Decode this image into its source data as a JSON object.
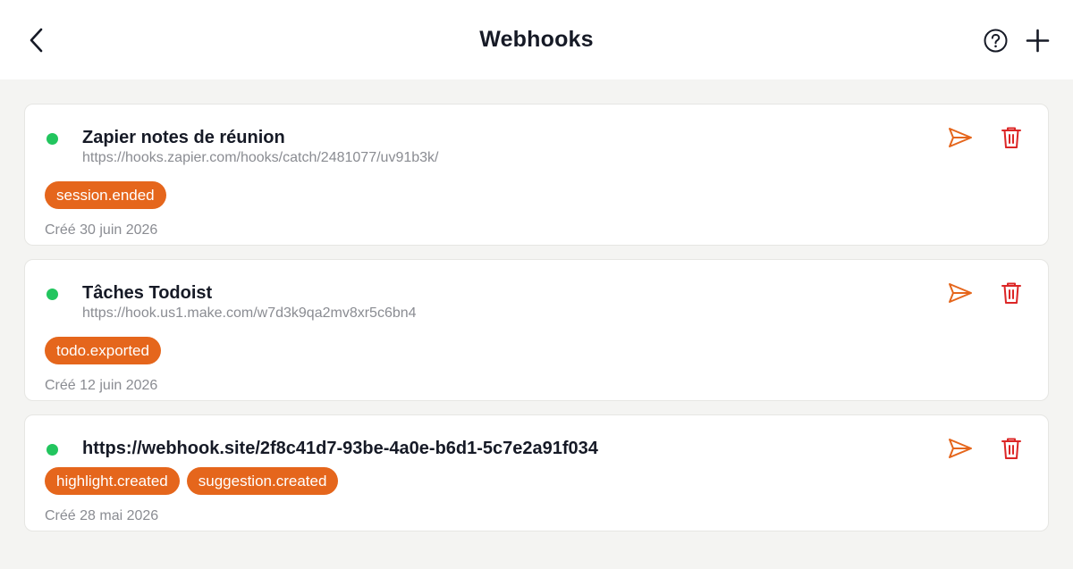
{
  "header": {
    "title": "Webhooks",
    "back_icon": "chevron-left-icon",
    "help_icon": "help-circle-icon",
    "add_icon": "plus-icon"
  },
  "colors": {
    "accent": "#e5661c",
    "delete": "#dc2626",
    "active": "#22c55e",
    "muted_text": "#8a8c92",
    "background": "#f4f4f2"
  },
  "webhooks": [
    {
      "name": "Zapier notes de réunion",
      "url": "https://hooks.zapier.com/hooks/catch/2481077/uv91b3k/",
      "events": [
        "session.ended"
      ],
      "created": "Créé 30 juin 2026",
      "status": "active"
    },
    {
      "name": "Tâches Todoist",
      "url": "https://hook.us1.make.com/w7d3k9qa2mv8xr5c6bn4",
      "events": [
        "todo.exported"
      ],
      "created": "Créé 12 juin 2026",
      "status": "active"
    },
    {
      "name": "https://webhook.site/2f8c41d7-93be-4a0e-b6d1-5c7e2a91f034",
      "url": "",
      "events": [
        "highlight.created",
        "suggestion.created"
      ],
      "created": "Créé 28 mai 2026",
      "status": "active"
    }
  ]
}
